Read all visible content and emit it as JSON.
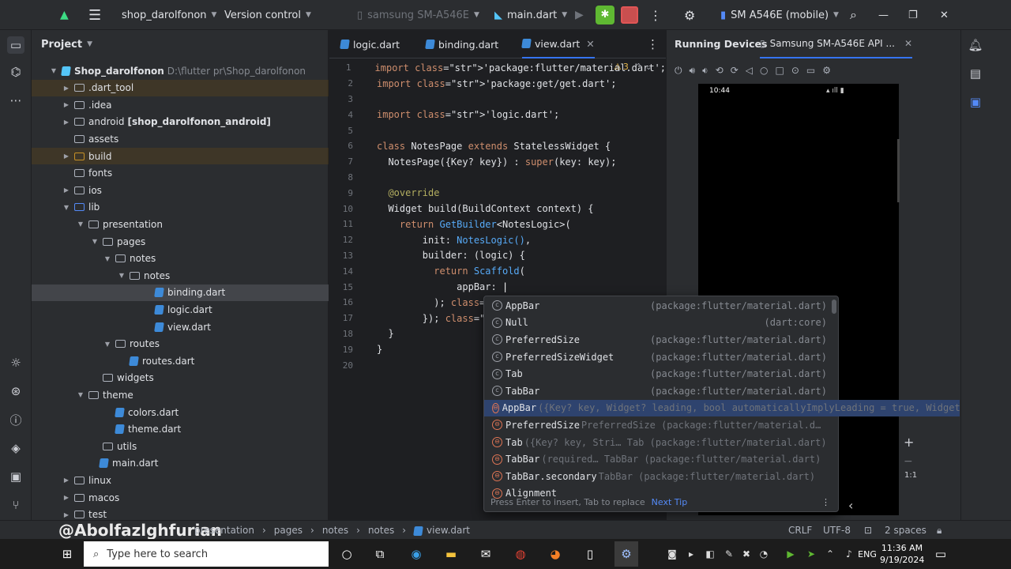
{
  "titlebar": {
    "project_name": "shop_darolfonon",
    "vcs": "Version control",
    "device_config": "samsung SM-A546E",
    "run_config": "main.dart",
    "running_device": "SM A546E (mobile)"
  },
  "project_panel": {
    "title": "Project",
    "tree": [
      {
        "label": "Shop_darolfonon",
        "extra": "D:\\flutter pr\\Shop_darolfonon",
        "kind": "root"
      },
      {
        "label": ".dart_tool",
        "kind": "folder"
      },
      {
        "label": ".idea",
        "kind": "folder"
      },
      {
        "label": "android",
        "extra": "[shop_darolfonon_android]",
        "kind": "folder"
      },
      {
        "label": "assets",
        "kind": "folder"
      },
      {
        "label": "build",
        "kind": "folder"
      },
      {
        "label": "fonts",
        "kind": "folder"
      },
      {
        "label": "ios",
        "kind": "folder"
      },
      {
        "label": "lib",
        "kind": "folder"
      },
      {
        "label": "presentation",
        "kind": "folder"
      },
      {
        "label": "pages",
        "kind": "folder"
      },
      {
        "label": "notes",
        "kind": "folder"
      },
      {
        "label": "notes",
        "kind": "folder"
      },
      {
        "label": "binding.dart",
        "kind": "file"
      },
      {
        "label": "logic.dart",
        "kind": "file"
      },
      {
        "label": "view.dart",
        "kind": "file"
      },
      {
        "label": "routes",
        "kind": "folder"
      },
      {
        "label": "routes.dart",
        "kind": "file"
      },
      {
        "label": "widgets",
        "kind": "folder"
      },
      {
        "label": "theme",
        "kind": "folder"
      },
      {
        "label": "colors.dart",
        "kind": "file"
      },
      {
        "label": "theme.dart",
        "kind": "file"
      },
      {
        "label": "utils",
        "kind": "folder"
      },
      {
        "label": "main.dart",
        "kind": "file"
      },
      {
        "label": "linux",
        "kind": "folder"
      },
      {
        "label": "macos",
        "kind": "folder"
      },
      {
        "label": "test",
        "kind": "folder"
      }
    ]
  },
  "editor": {
    "tabs": [
      "logic.dart",
      "binding.dart",
      "view.dart"
    ],
    "warning_count": "3",
    "lines": [
      {
        "n": "1",
        "text": "import 'package:flutter/material.dart';"
      },
      {
        "n": "2",
        "text": "import 'package:get/get.dart';"
      },
      {
        "n": "3",
        "text": ""
      },
      {
        "n": "4",
        "text": "import 'logic.dart';"
      },
      {
        "n": "5",
        "text": ""
      },
      {
        "n": "6",
        "text": "class NotesPage extends StatelessWidget {"
      },
      {
        "n": "7",
        "text": "  NotesPage({Key? key}) : super(key: key);"
      },
      {
        "n": "8",
        "text": ""
      },
      {
        "n": "9",
        "text": "  @override"
      },
      {
        "n": "10",
        "text": "  Widget build(BuildContext context) {"
      },
      {
        "n": "11",
        "text": "    return GetBuilder<NotesLogic>("
      },
      {
        "n": "12",
        "text": "        init: NotesLogic(),"
      },
      {
        "n": "13",
        "text": "        builder: (logic) {"
      },
      {
        "n": "14",
        "text": "          return Scaffold("
      },
      {
        "n": "15",
        "text": "              appBar: "
      },
      {
        "n": "16",
        "text": "          ); // Sc"
      },
      {
        "n": "17",
        "text": "        }); // Get"
      },
      {
        "n": "18",
        "text": "  }"
      },
      {
        "n": "19",
        "text": "}"
      },
      {
        "n": "20",
        "text": ""
      }
    ]
  },
  "completion": {
    "items": [
      {
        "kind": "c",
        "name": "AppBar",
        "sig": "",
        "type": "(package:flutter/material.dart)"
      },
      {
        "kind": "c",
        "name": "Null",
        "sig": "",
        "type": "(dart:core)"
      },
      {
        "kind": "c",
        "name": "PreferredSize",
        "sig": "",
        "type": "(package:flutter/material.dart)"
      },
      {
        "kind": "c",
        "name": "PreferredSizeWidget",
        "sig": "",
        "type": "(package:flutter/material.dart)"
      },
      {
        "kind": "c",
        "name": "Tab",
        "sig": "",
        "type": "(package:flutter/material.dart)"
      },
      {
        "kind": "c",
        "name": "TabBar",
        "sig": "",
        "type": "(package:flutter/material.dart)"
      },
      {
        "kind": "m",
        "name": "AppBar",
        "sig": "({Key? key, Widget? leading, bool automaticallyImplyLeading = true, Widget",
        "type": ""
      },
      {
        "kind": "m",
        "name": "PreferredSize",
        "sig": " PreferredSize (package:flutter/material.d…",
        "type": ""
      },
      {
        "kind": "m",
        "name": "Tab",
        "sig": "({Key? key, Stri… Tab (package:flutter/material.dart)",
        "type": ""
      },
      {
        "kind": "m",
        "name": "TabBar",
        "sig": "(required… TabBar (package:flutter/material.dart)",
        "type": ""
      },
      {
        "kind": "m",
        "name": "TabBar.secondary",
        "sig": " TabBar (package:flutter/material.dart)",
        "type": ""
      },
      {
        "kind": "m",
        "name": "Alignment",
        "sig": "",
        "type": ""
      }
    ],
    "footer_hint": "Press Enter to insert, Tab to replace",
    "next_tip": "Next Tip"
  },
  "devices": {
    "title": "Running Devices",
    "device_tab": "Samsung SM-A546E API ...",
    "phone_status_time": "10:44",
    "zoom_label": "1:1"
  },
  "statusbar": {
    "breadcrumb": [
      "presentation",
      "pages",
      "notes",
      "notes",
      "view.dart"
    ],
    "watermark": "@Abolfazlghfurian",
    "line_sep": "CRLF",
    "encoding": "UTF-8",
    "indent": "2 spaces"
  },
  "taskbar": {
    "search_placeholder": "Type here to search",
    "time": "11:36 AM",
    "date": "9/19/2024",
    "lang": "ENG"
  },
  "colors": {
    "accent": "#3574f0",
    "bg": "#1e1f22",
    "panel": "#2b2d30"
  }
}
